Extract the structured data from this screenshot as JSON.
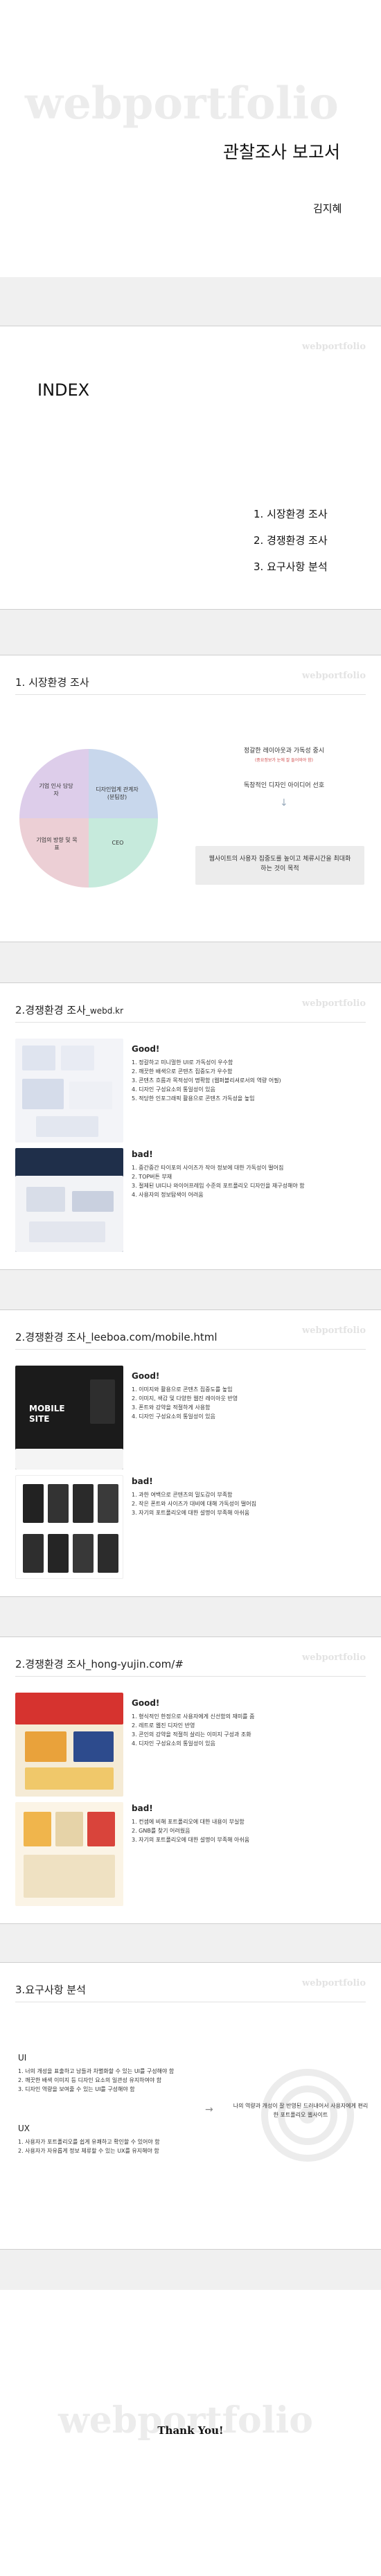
{
  "cover": {
    "watermark": "webportfolio",
    "title": "관찰조사 보고서",
    "author": "김지혜"
  },
  "index": {
    "watermark": "webportfolio",
    "heading": "INDEX",
    "items": [
      "1. 시장환경 조사",
      "2. 경쟁환경 조사",
      "3. 요구사항 분석"
    ]
  },
  "market": {
    "watermark": "webportfolio",
    "title": "1. 시장환경 조사",
    "pie_labels": [
      "디자인업계 관계자 (분팀장)",
      "CEO",
      "기업의 방향 및 목표",
      "기업 인사 담당자"
    ],
    "pie_colors": [
      "#c8d7ec",
      "#c6eadc",
      "#eccfd5",
      "#ddcdea"
    ],
    "note_main": "정갈한 레이아웃과 가독성 중시",
    "note_sub": "(중요정보가 눈에 잘 들어와야 함)",
    "note_2": "독창적인 디자인 아이디어 선호",
    "callout": "웹사이트의 사용자 집중도를 높이고 체류시간을 최대화하는 것이 목적"
  },
  "comp1": {
    "watermark": "webportfolio",
    "title": "2.경쟁환경 조사",
    "title_suffix": "_webd.kr",
    "good_label": "Good!",
    "good": [
      "1. 정갈하고 미니멀한 UI로 가독성이 우수함",
      "2. 깨끗한 배색으로 콘텐츠 집중도가 우수함",
      "3. 콘텐츠 흐름과 목적성이 명확함 (웹퍼블리셔로서의 역량 어필)",
      "4. 디자인 구성요소의 통일성이 있음",
      "5. 적당한 인포그래픽 활용으로 콘텐츠 가독성을 높임"
    ],
    "bad_label": "bad!",
    "bad": [
      "1. 중간중간 타이포의 사이즈가 작아 정보에 대한 가독성이 떨어짐",
      "2. TOP버튼 부재",
      "3. 절제된 UI디나 와이어프레임 수준의 포트폴리오 디자인을 재구성해야 함",
      "4. 사용자의 정보탐색이 어려움"
    ]
  },
  "comp2": {
    "watermark": "webportfolio",
    "title": "2.경쟁환경 조사",
    "title_suffix": "_leeboa.com/mobile.html",
    "hero_text": "MOBILE SITE",
    "good_label": "Good!",
    "good": [
      "1. 이미지와 활용으로 콘텐츠 집중도를 높임",
      "2. 이미지, 색감 및 다양한 웹진 레이아웃 반영",
      "3. 폰트와 강약을 적절하게 사용함",
      "4. 디자인 구성요소의 통일성이 있음"
    ],
    "bad_label": "bad!",
    "bad": [
      "1. 과한 여백으로 콘텐츠의 밀도감이 부족함",
      "2. 작은 폰트와 사이즈가 대비에 대해 가독성이 떨어짐",
      "3. 자기의 포트폴리오에 대한 설명이 부족해 아쉬움"
    ]
  },
  "comp3": {
    "watermark": "webportfolio",
    "title": "2.경쟁환경 조사",
    "title_suffix": "_hong-yujin.com/#",
    "good_label": "Good!",
    "good": [
      "1. 형식적인 한정으로 사용자에게 신선함의 재미를 줌",
      "2. 레트로 웹진 디자인 반영",
      "3. 콘인의 강약을 적절히 살리는 이미지 구성과 조화",
      "4. 디자인 구성요소의 통일성이 있음"
    ],
    "bad_label": "bad!",
    "bad": [
      "1. 컨셉에 비해 포트폴리오에 대한 내용이 부실함",
      "2. GNB를 찾기 어려웠음",
      "3. 자기의 포트폴리오에 대한 설명이 부족해 아쉬움"
    ]
  },
  "req": {
    "watermark": "webportfolio",
    "title": "3.요구사항 분석",
    "ui_label": "UI",
    "ui": [
      "1. 너의 개성을 표출하고 남들과 차별화할 수 있는 UI를 구성해야 함",
      "2. 깨끗한 배색 이미지 등 디자인 요소의 일관성 유지하여야 함",
      "3. 디자인 역량을 보여줄 수 있는 UI를 구성해야 함"
    ],
    "ux_label": "UX",
    "ux": [
      "1. 사용자가 포트폴리오를 쉽게 유쾌하고 확인할 수 있어야 함",
      "2. 사용자가 자유롭게 정보 체류할 수 있는 UX를 유지해야 함"
    ],
    "arrow": "→",
    "conclusion": "나의 역량과 개성이 잘 반영된 드러내어서 사용자에게 편리한 포트폴리오 웹사이트"
  },
  "end": {
    "watermark": "webportfolio",
    "thanks": "Thank You!"
  }
}
